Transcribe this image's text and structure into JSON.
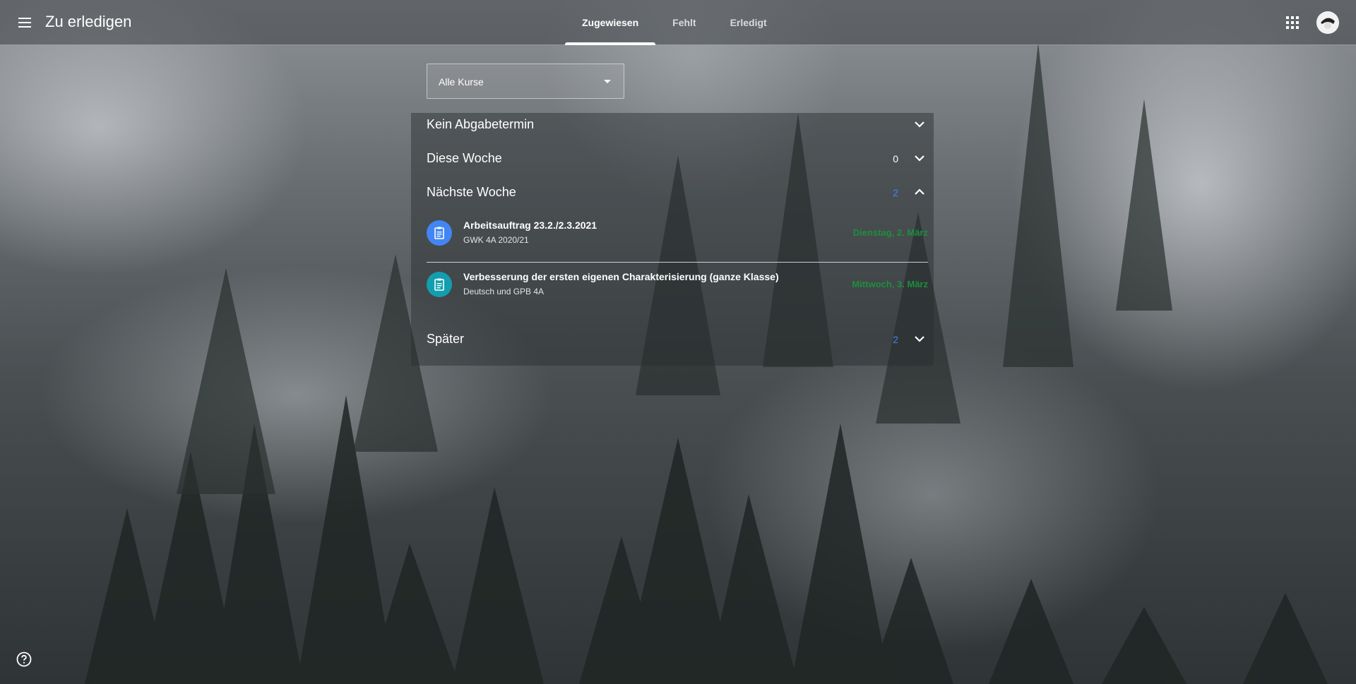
{
  "header": {
    "title": "Zu erledigen",
    "tabs": [
      {
        "label": "Zugewiesen",
        "active": true
      },
      {
        "label": "Fehlt",
        "active": false
      },
      {
        "label": "Erledigt",
        "active": false
      }
    ],
    "menu_icon": "hamburger-menu-icon",
    "apps_icon": "apps-grid-icon"
  },
  "filter": {
    "selected": "Alle Kurse"
  },
  "sections": [
    {
      "label": "Kein Abgabetermin",
      "count": "",
      "expanded": false
    },
    {
      "label": "Diese Woche",
      "count": "0",
      "expanded": false
    },
    {
      "label": "Nächste Woche",
      "count": "2",
      "expanded": true
    },
    {
      "label": "Später",
      "count": "2",
      "expanded": false
    }
  ],
  "items": [
    {
      "title": "Arbeitsauftrag 23.2./2.3.2021",
      "course": "GWK 4A 2020/21",
      "due": "Dienstag, 2. März",
      "icon": "assignment-icon",
      "color": "#4285f4"
    },
    {
      "title": "Verbesserung der ersten eigenen Charakterisierung (ganze Klasse)",
      "course": "Deutsch und GPB 4A",
      "due": "Mittwoch, 3. März",
      "icon": "assignment-icon",
      "color": "#129eaf"
    }
  ],
  "colors": {
    "count_blue": "#4285f4",
    "count_white": "#ffffff",
    "due_green": "#1e8e3e"
  }
}
